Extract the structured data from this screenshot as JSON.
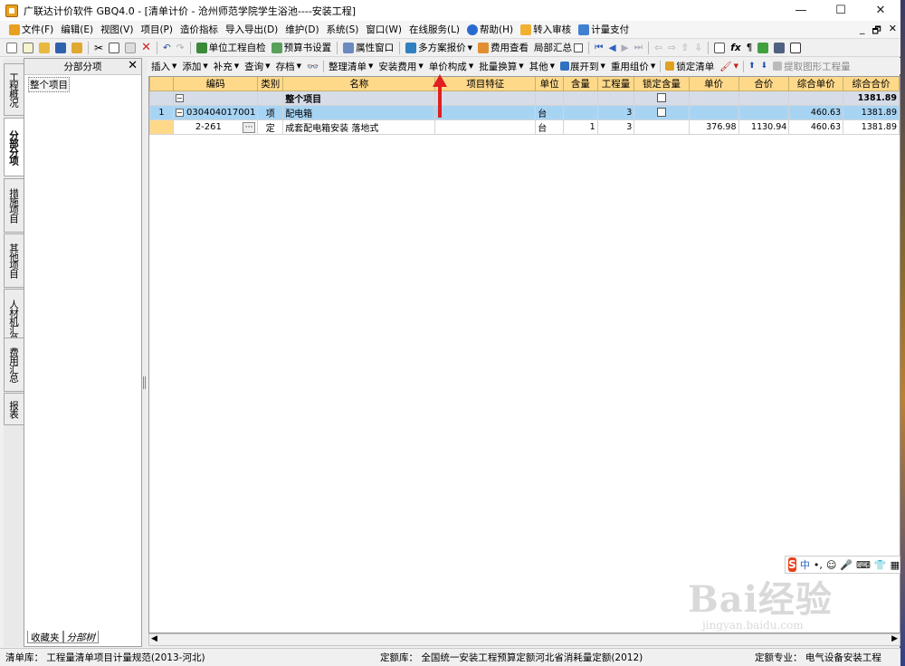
{
  "window": {
    "title": "广联达计价软件 GBQ4.0 - [清单计价 - 沧州师范学院学生浴池----安装工程]",
    "controls": [
      "—",
      "☐",
      "✕"
    ]
  },
  "menu": [
    {
      "label": "文件(F)"
    },
    {
      "label": "编辑(E)"
    },
    {
      "label": "视图(V)"
    },
    {
      "label": "项目(P)"
    },
    {
      "label": "造价指标"
    },
    {
      "label": "导入导出(D)"
    },
    {
      "label": "维护(D)"
    },
    {
      "label": "系统(S)"
    },
    {
      "label": "窗口(W)"
    },
    {
      "label": "在线服务(L)"
    },
    {
      "label": "帮助(H)"
    },
    {
      "label": "转入审核"
    },
    {
      "label": "计量支付"
    }
  ],
  "mdi_controls": [
    "_",
    "🗗",
    "✕"
  ],
  "toolbar1": {
    "unit_check": "单位工程自检",
    "budget_settings": "预算书设置",
    "property_window": "属性窗口",
    "multi_quote": "多方案报价",
    "fee_view": "费用查看",
    "partial_summary": "局部汇总"
  },
  "left_tabs": [
    "工程概况",
    "分部分项",
    "措施项目",
    "其他项目",
    "人材机汇总",
    "费用汇总",
    "报表"
  ],
  "tree": {
    "header": "分部分项",
    "close": "✕",
    "root": "整个项目",
    "bottom_tabs": [
      "收藏夹",
      "分部树"
    ]
  },
  "toolbar2": {
    "insert": "插入",
    "add": "添加",
    "supplement": "补充",
    "query": "查询",
    "save": "存档",
    "organize": "整理清单",
    "install_fee": "安装费用",
    "unit_price_comp": "单价构成",
    "batch_convert": "批量换算",
    "other": "其他",
    "expand_to": "展开到",
    "reuse_price": "重用组价",
    "lock_list": "锁定清单",
    "extract_qty": "提取图形工程量"
  },
  "grid": {
    "columns": [
      "",
      "编码",
      "类别",
      "名称",
      "项目特征",
      "单位",
      "含量",
      "工程量",
      "锁定含量",
      "单价",
      "合价",
      "综合单价",
      "综合合价"
    ],
    "rows": [
      {
        "rn": "",
        "code": "",
        "type": "",
        "name": "整个项目",
        "feature": "",
        "unit": "",
        "content": "",
        "qty": "",
        "unit_price": "",
        "total": "",
        "comp_price": "",
        "comp_total": "1381.89"
      },
      {
        "rn": "1",
        "code": "030404017001",
        "type": "项",
        "name": "配电箱",
        "feature": "",
        "unit": "台",
        "content": "",
        "qty": "3",
        "unit_price": "",
        "total": "",
        "comp_price": "460.63",
        "comp_total": "1381.89"
      },
      {
        "rn": "",
        "code": "2-261",
        "type": "定",
        "name": "成套配电箱安装 落地式",
        "feature": "",
        "unit": "台",
        "content": "1",
        "qty": "3",
        "unit_price": "376.98",
        "total": "1130.94",
        "comp_price": "460.63",
        "comp_total": "1381.89"
      }
    ]
  },
  "status": {
    "list_lib": "清单库：  工程量清单项目计量规范(2013-河北)",
    "quota_lib": "定额库：  全国统一安装工程预算定额河北省消耗量定额(2012)",
    "quota_major": "定额专业：  电气设备安装工程"
  },
  "ime": {
    "logo": "S",
    "lang": "中",
    "punct": "•,"
  },
  "watermark": {
    "main": "Bai经验",
    "sub": "jingyan.baidu.com"
  },
  "colors": {
    "header_orange": "#ffd98a",
    "selected_row": "#a8d4f4",
    "total_row": "#d6dce8",
    "annotation_arrow": "#e02020"
  }
}
